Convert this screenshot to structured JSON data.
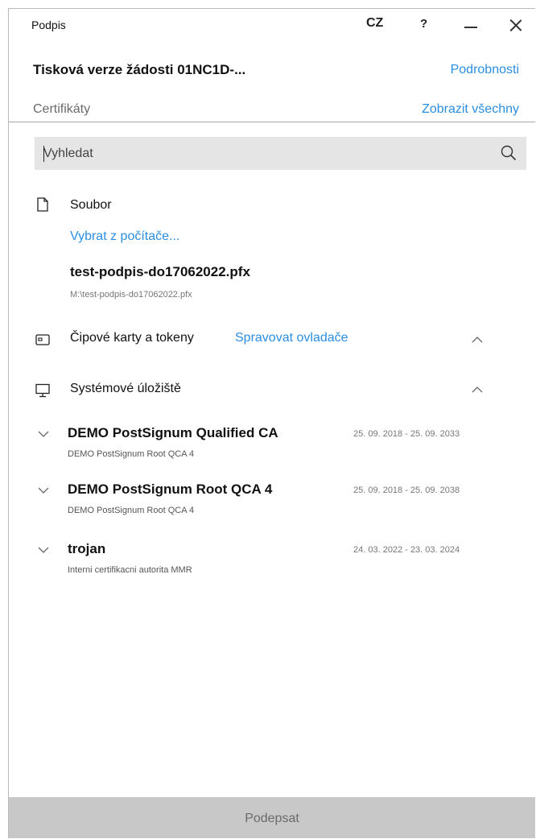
{
  "window": {
    "title": "Podpis",
    "language": "CZ",
    "help": "?"
  },
  "header": {
    "document_title": "Tisková verze žádosti 01NC1D-...",
    "details_link": "Podrobnosti",
    "certificates_label": "Certifikáty",
    "show_all_link": "Zobrazit všechny"
  },
  "search": {
    "placeholder": "Vyhledat"
  },
  "file_section": {
    "label": "Soubor",
    "choose_link": "Vybrat z počítače...",
    "file_name": "test-podpis-do17062022.pfx",
    "file_path": "M:\\test-podpis-do17062022.pfx"
  },
  "smartcard_section": {
    "label": "Čipové karty a tokeny",
    "manage_link": "Spravovat ovladače"
  },
  "system_store_section": {
    "label": "Systémové úložiště"
  },
  "certificates": [
    {
      "name": "DEMO PostSignum Qualified CA",
      "validity": "25. 09. 2018 - 25. 09. 2033",
      "issuer": "DEMO PostSignum Root QCA 4"
    },
    {
      "name": "DEMO PostSignum Root QCA 4",
      "validity": "25. 09. 2018 - 25. 09. 2038",
      "issuer": "DEMO PostSignum Root QCA 4"
    },
    {
      "name": "trojan",
      "validity": "24. 03. 2022 - 23. 03. 2024",
      "issuer": "Interni certifikacni autorita MMR"
    }
  ],
  "footer": {
    "sign_button": "Podepsat"
  },
  "colors": {
    "link": "#2b8ee0",
    "search_bg": "#e5e5e5",
    "button_disabled_bg": "#c8c8c8"
  }
}
